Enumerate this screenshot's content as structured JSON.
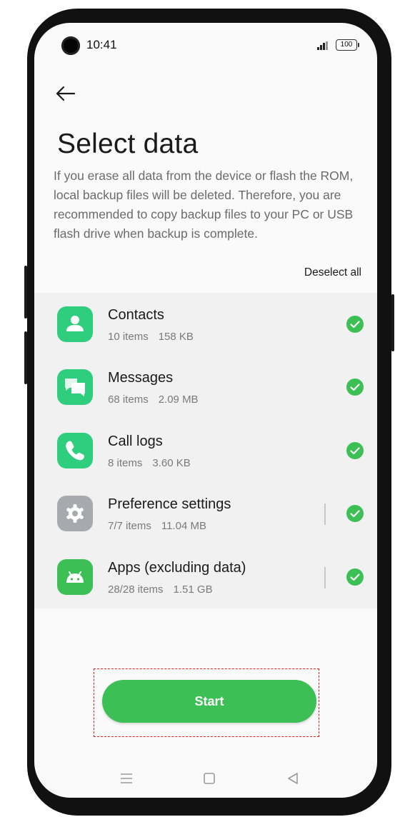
{
  "status_bar": {
    "time": "10:41",
    "battery": "100"
  },
  "header": {
    "back_icon": "arrow-left-icon",
    "title": "Select data",
    "description": "If you erase all data from the device or flash the ROM, local backup files will be deleted. Therefore, you are recommended to copy backup files to your PC or USB flash drive when backup is complete."
  },
  "actions": {
    "deselect_all": "Deselect all",
    "start": "Start"
  },
  "items": [
    {
      "name": "Contacts",
      "count": "10 items",
      "size": "158 KB",
      "icon": "contacts-icon",
      "checked": true
    },
    {
      "name": "Messages",
      "count": "68 items",
      "size": "2.09 MB",
      "icon": "messages-icon",
      "checked": true
    },
    {
      "name": "Call logs",
      "count": "8 items",
      "size": "3.60 KB",
      "icon": "phone-icon",
      "checked": true
    },
    {
      "name": "Preference settings",
      "count": "7/7 items",
      "size": "11.04 MB",
      "icon": "settings-gear-icon",
      "checked": true
    },
    {
      "name": "Apps (excluding data)",
      "count": "28/28 items",
      "size": "1.51 GB",
      "icon": "android-icon",
      "checked": true
    }
  ],
  "navigation": [
    "menu-icon",
    "home-icon",
    "back-triangle-icon"
  ],
  "colors": {
    "accent_green": "#3cbf54",
    "icon_green": "#2fce7f",
    "settings_gray": "#a7a9ae",
    "highlight_red": "#e02020"
  }
}
